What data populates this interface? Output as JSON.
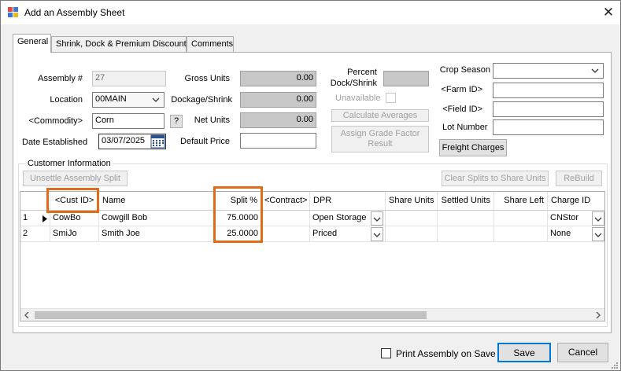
{
  "window": {
    "title": "Add an Assembly Sheet"
  },
  "tabs": [
    "General",
    "Shrink, Dock & Premium Discount",
    "Comments"
  ],
  "form": {
    "assembly_label": "Assembly #",
    "assembly_value": "27",
    "location_label": "Location",
    "location_value": "00MAIN",
    "commodity_label": "<Commodity>",
    "commodity_value": "Corn",
    "commodity_help": "?",
    "date_label": "Date Established",
    "date_value": "03/07/2025",
    "gross_units_label": "Gross Units",
    "gross_units_value": "0.00",
    "dockage_label": "Dockage/Shrink",
    "dockage_value": "0.00",
    "net_units_label": "Net Units",
    "net_units_value": "0.00",
    "default_price_label": "Default Price",
    "default_price_value": "",
    "percent_dock_label_1": "Percent",
    "percent_dock_label_2": "Dock/Shrink",
    "unavailable_label": "Unavailable",
    "calc_averages_label": "Calculate Averages",
    "assign_grade_label_1": "Assign Grade Factor",
    "assign_grade_label_2": "Result",
    "crop_season_label": "Crop Season",
    "crop_season_value": "",
    "farm_id_label": "<Farm ID>",
    "farm_id_value": "",
    "field_id_label": "<Field ID>",
    "field_id_value": "",
    "lot_number_label": "Lot Number",
    "lot_number_value": "",
    "freight_charges_label": "Freight Charges"
  },
  "customer": {
    "group_label": "Customer Information",
    "unsettle_label": "Unsettle Assembly Split",
    "clear_splits_label": "Clear Splits to Share Units",
    "rebuild_label": "ReBuild",
    "columns": [
      "<Cust ID>",
      "Name",
      "Split %",
      "<Contract>",
      "DPR",
      "Share Units",
      "Settled Units",
      "Share Left",
      "Charge ID"
    ],
    "rows": [
      {
        "num": "1",
        "cust_id": "CowBo",
        "name": "Cowgill Bob",
        "split": "75.0000",
        "contract": "",
        "dpr": "Open Storage",
        "share_units": "",
        "settled_units": "",
        "share_left": "",
        "charge_id": "CNStor"
      },
      {
        "num": "2",
        "cust_id": "SmiJo",
        "name": "Smith Joe",
        "split": "25.0000",
        "contract": "",
        "dpr": "Priced",
        "share_units": "",
        "settled_units": "",
        "share_left": "",
        "charge_id": "None"
      }
    ]
  },
  "footer": {
    "print_label": "Print Assembly on Save",
    "save_label": "Save",
    "cancel_label": "Cancel"
  },
  "colors": {
    "highlight": "#e06c1b",
    "accent": "#0078d7"
  },
  "icons": [
    "app-icon",
    "close-icon",
    "calendar-icon",
    "chevron-down-icon",
    "row-pointer-icon",
    "scroll-left-icon",
    "scroll-right-icon"
  ]
}
